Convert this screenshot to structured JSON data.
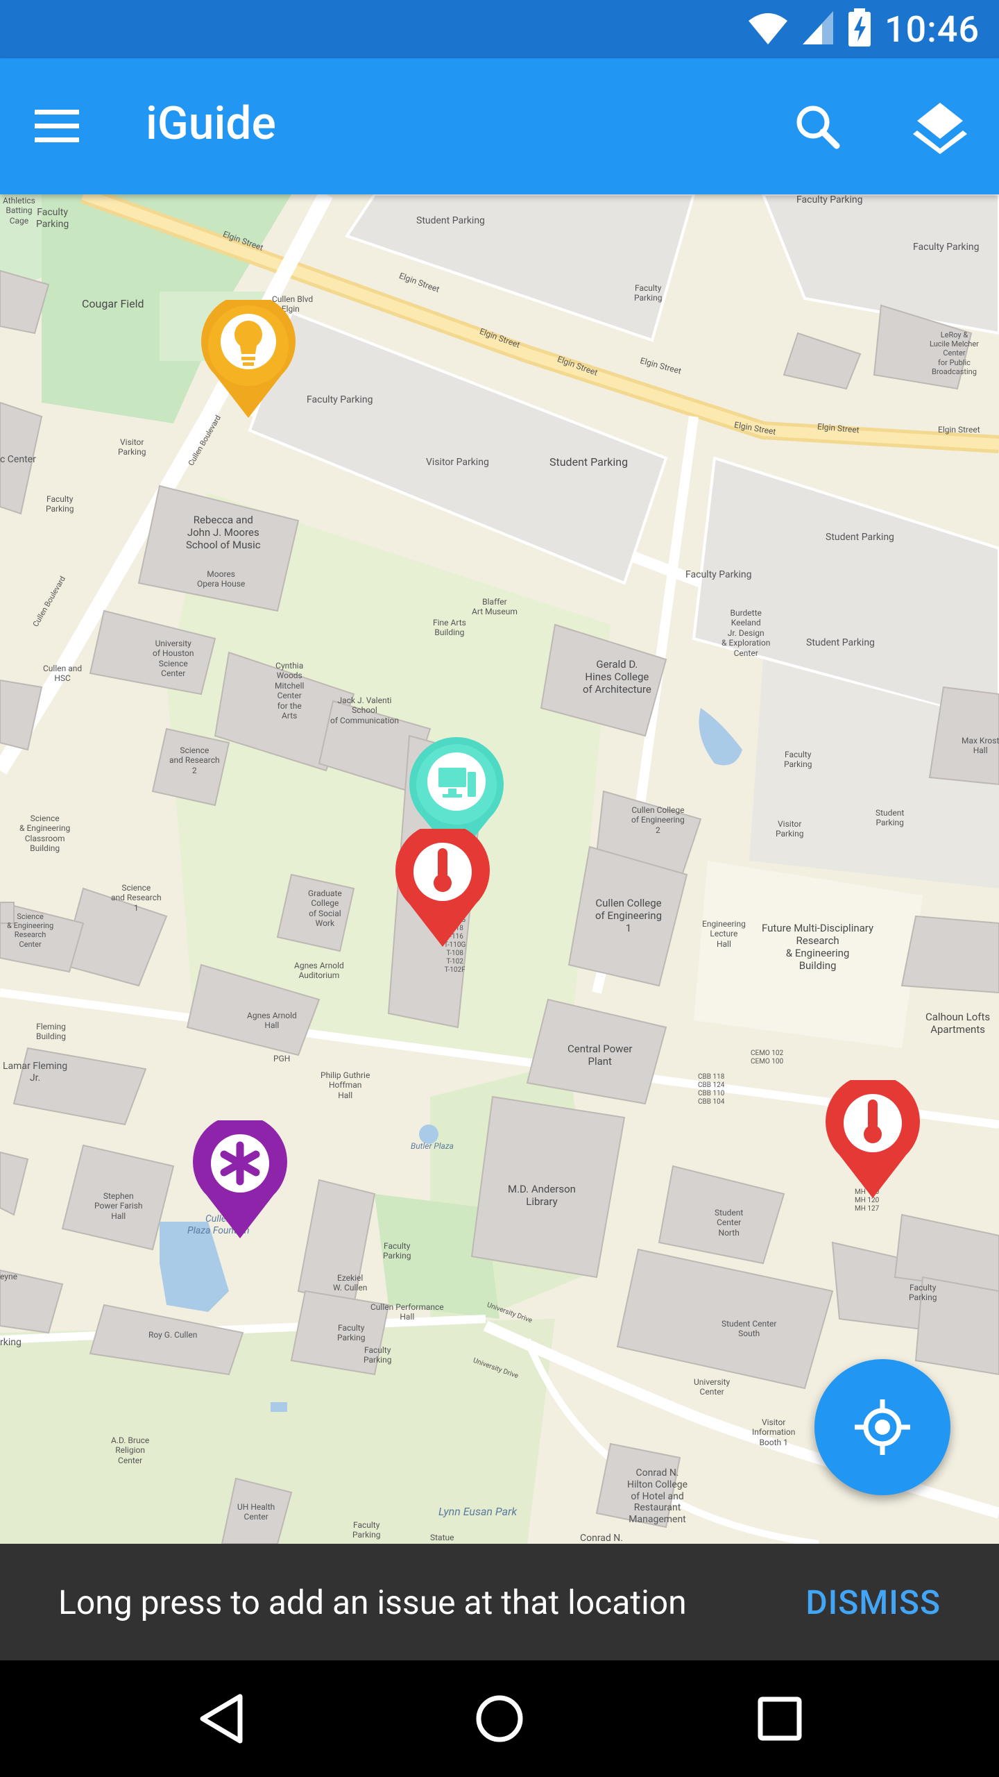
{
  "status_bar": {
    "time": "10:46"
  },
  "app_bar": {
    "title": "iGuide",
    "search_icon": "search-icon",
    "layers_icon": "layers-icon",
    "menu_icon": "menu-icon"
  },
  "map": {
    "labels": {
      "athletics": "Athletics\nBatting\nCage",
      "faculty_parking_1": "Faculty\nParking",
      "cougar_field": "Cougar Field",
      "elgin_street_1": "Elgin Street",
      "elgin_street_2": "Elgin Street",
      "elgin_street_3": "Elgin Street",
      "elgin_street_4": "Elgin Street",
      "elgin_street_5": "Elgin Street",
      "elgin_street_6": "Elgin Street",
      "elgin_street_7": "Elgin Street",
      "elgin_street_8": "Elgin Street",
      "cullen_blvd_elgin": "Cullen Blvd\n@ Elgin\nSt",
      "student_parking_top": "Student Parking",
      "faculty_parking_top_right": "Faculty Parking",
      "faculty_parking_far_right": "Faculty Parking",
      "faculty_parking_small": "Faculty\nParking",
      "leroy": "LeRoy &\nLucile Melcher\nCenter\nfor Public\nBroadcasting",
      "faculty_parking_mid": "Faculty Parking",
      "cullen_boulevard": "Cullen Boulevard",
      "visitor_parking_left": "Visitor\nParking",
      "c_center": "c Center",
      "visitor_parking": "Visitor Parking",
      "student_parking_mid": "Student Parking",
      "faculty_parking_left": "Faculty\nParking",
      "moores_music": "Rebecca and\nJohn J. Moores\nSchool of Music",
      "moores_opera": "Moores\nOpera House",
      "student_parking_right": "Student Parking",
      "faculty_parking_center": "Faculty Parking",
      "blaffer": "Blaffer\nArt Museum",
      "fine_arts": "Fine Arts\nBuilding",
      "burdette": "Burdette\nKeeland\nJr. Design\n& Exploration\nCenter",
      "student_parking_right2": "Student Parking",
      "cullen_boulevard_2": "Cullen Boulevard",
      "uh_science_center": "University\nof Houston\nScience\nCenter",
      "cullen_hsc": "Cullen and\nHSC",
      "cynthia_woods": "Cynthia\nWoods\nMitchell\nCenter\nfor the\nArts",
      "jack_valenti": "Jack J. Valenti\nSchool\nof Communication",
      "hines": "Gerald D.\nHines College\nof Architecture",
      "science_research_2": "Science\nand Research\n2",
      "faculty_parking_right_mid": "Faculty\nParking",
      "max_krost": "Max Krost\nHall",
      "cullen_eng_2": "Cullen College\nof Engineering\n2",
      "visitor_parking_right": "Visitor\nParking",
      "student_parking_far": "Student\nParking",
      "science_eng_classroom": "Science\n& Engineering\nClassroom\nBuilding",
      "science_research_1": "Science\nand Research\n1",
      "graduate_social": "Graduate\nCollege\nof Social\nWork",
      "cullen_eng_1": "Cullen College\nof Engineering\n1",
      "eng_lecture": "Engineering\nLecture\nHall",
      "future_research": "Future Multi-Disciplinary\nResearch\n& Engineering\nBuilding",
      "science_eng_research": "Science\n& Engineering\nResearch\nCenter",
      "agnes_auditorium": "Agnes Arnold\nAuditorium",
      "t_rooms": "T-120G\nT-118\nT-116\nT-110G\nT-108\nT-102\nT-102F",
      "fleming": "Fleming\nBuilding",
      "agnes_hall": "Agnes Arnold\nHall",
      "central_power": "Central Power\nPlant",
      "calhoun": "Calhoun Lofts\nApartments",
      "cemo": "CEMO 102\nCEMO 100",
      "lamar_fleming": "Lamar Fleming\nJr.",
      "pgh": "PGH",
      "philip_guthrie": "Philip Guthrie\nHoffman\nHall",
      "cbb": "CBB 118\nCBB 124\nCBB 110\nCBB 104",
      "butler_plaza": "Butler Plaza",
      "md_anderson": "M.D. Anderson\nLibrary",
      "stephen_farish": "Stephen\nPower Farish\nHall",
      "cullen_plaza": "Cullen\nPlaza Fountain",
      "faculty_parking_bottom": "Faculty\nParking",
      "student_center_north": "Student\nCenter\nNorth",
      "mh_rooms": "MH 160\nMH 120\nMH 127",
      "eyne": "eyne",
      "ezekiel": "Ezekiel\nW. Cullen",
      "cullen_performance": "Cullen Performance\nHall",
      "roy_cullen": "Roy G. Cullen",
      "university_drive_1": "University Drive",
      "student_center_south": "Student Center\nSouth",
      "faculty_parking_br": "Faculty\nParking",
      "rking": "rking",
      "faculty_parking_bl1": "Faculty\nParking",
      "faculty_parking_bl2": "Faculty\nParking",
      "university_drive_2": "University Drive",
      "university_center": "University\nCenter",
      "visitor_info": "Visitor\nInformation\nBooth 1",
      "ad_bruce": "A.D. Bruce\nReligion\nCenter",
      "conrad_hilton": "Conrad N.\nHilton College\nof Hotel and\nRestaurant\nManagement",
      "uh_health": "UH Health\nCenter",
      "lynn_eusan": "Lynn Eusan Park",
      "faculty_parking_b": "Faculty\nParking",
      "statue": "Statue",
      "conrad_n": "Conrad N."
    },
    "pins": [
      {
        "icon": "lightbulb-icon",
        "color": "#f5b324"
      },
      {
        "icon": "computer-icon",
        "color": "#5ee3cf"
      },
      {
        "icon": "thermometer-icon",
        "color": "#e53935"
      },
      {
        "icon": "thermometer-icon",
        "color": "#e53935"
      },
      {
        "icon": "asterisk-icon",
        "color": "#8e24aa"
      }
    ]
  },
  "fab": {
    "icon": "my-location-icon"
  },
  "snackbar": {
    "message": "Long press to add an issue at that location",
    "action": "DISMISS"
  },
  "nav_bar": {
    "back_icon": "back-icon",
    "home_icon": "home-icon",
    "recents_icon": "recents-icon"
  }
}
